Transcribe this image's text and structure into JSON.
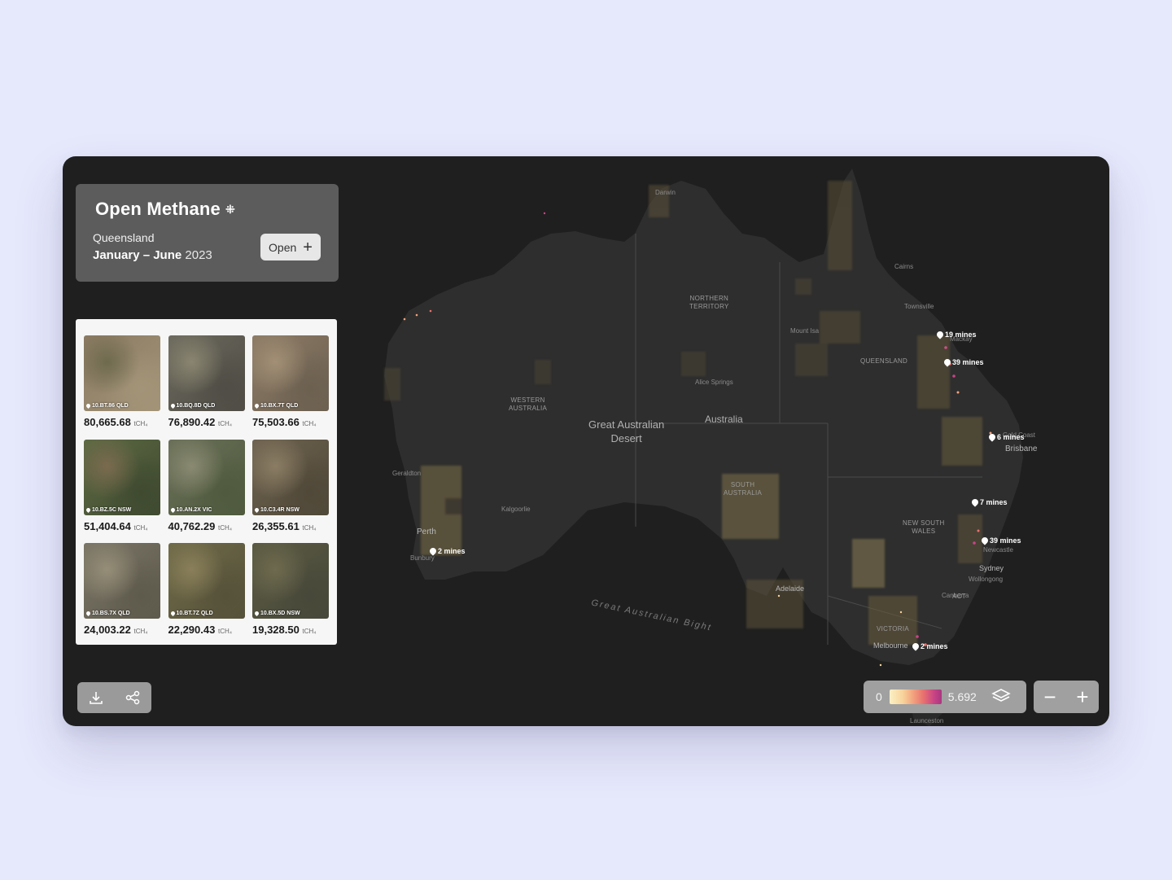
{
  "app": {
    "title": "Open Methane",
    "logo_mark": "⁜",
    "region": "Queensland",
    "period_range": "January – June",
    "period_year": "2023",
    "open_button": "Open",
    "open_icon": "plus-icon"
  },
  "sites": [
    {
      "id": "10.BT.86 QLD",
      "value": "80,665.68",
      "unit": "tCH₄"
    },
    {
      "id": "10.BQ.8D QLD",
      "value": "76,890.42",
      "unit": "tCH₄"
    },
    {
      "id": "10.BX.7T QLD",
      "value": "75,503.66",
      "unit": "tCH₄"
    },
    {
      "id": "10.BZ.5C NSW",
      "value": "51,404.64",
      "unit": "tCH₄"
    },
    {
      "id": "10.AN.2X VIC",
      "value": "40,762.29",
      "unit": "tCH₄"
    },
    {
      "id": "10.C3.4R NSW",
      "value": "26,355.61",
      "unit": "tCH₄"
    },
    {
      "id": "10.BS.7X QLD",
      "value": "24,003.22",
      "unit": "tCH₄"
    },
    {
      "id": "10.BT.7Z QLD",
      "value": "22,290.43",
      "unit": "tCH₄"
    },
    {
      "id": "10.BX.5D NSW",
      "value": "19,328.50",
      "unit": "tCH₄"
    }
  ],
  "map": {
    "regions": {
      "nt": "NORTHERN\nTERRITORY",
      "wa": "WESTERN\nAUSTRALIA",
      "qld": "QUEENSLAND",
      "sa": "SOUTH\nAUSTRALIA",
      "nsw": "NEW SOUTH\nWALES",
      "vic": "VICTORIA",
      "act": "ACT"
    },
    "features": {
      "desert": "Great Australian\nDesert",
      "country": "Australia",
      "bight": "Great Australian Bight"
    },
    "cities": {
      "darwin": "Darwin",
      "cairns": "Cairns",
      "townsville": "Townsville",
      "mackay": "Mackay",
      "mount_isa": "Mount Isa",
      "alice_springs": "Alice Springs",
      "gold_coast": "Gold Coast",
      "brisbane": "Brisbane",
      "geraldton": "Geraldton",
      "kalgoorlie": "Kalgoorlie",
      "perth": "Perth",
      "bunbury": "Bunbury",
      "adelaide": "Adelaide",
      "newcastle": "Newcastle",
      "sydney": "Sydney",
      "wollongong": "Wollongong",
      "canberra": "Canberra",
      "melbourne": "Melbourne",
      "launceston": "Launceston"
    },
    "clusters": {
      "c1": "19 mines",
      "c2": "39 mines",
      "c3": "6 mines",
      "c4": "7 mines",
      "c5": "39 mines",
      "c6": "2 mines",
      "c7": "2 mines"
    }
  },
  "legend": {
    "min": "0",
    "max": "5.692",
    "colors": [
      "#fbf0c6",
      "#f7d49b",
      "#f2a37e",
      "#e8716e",
      "#c94486",
      "#a9377f"
    ]
  },
  "toolbar": {
    "download_icon": "download-icon",
    "share_icon": "share-icon",
    "layers_icon": "layers-icon",
    "zoom_out": "−",
    "zoom_in": "+"
  }
}
